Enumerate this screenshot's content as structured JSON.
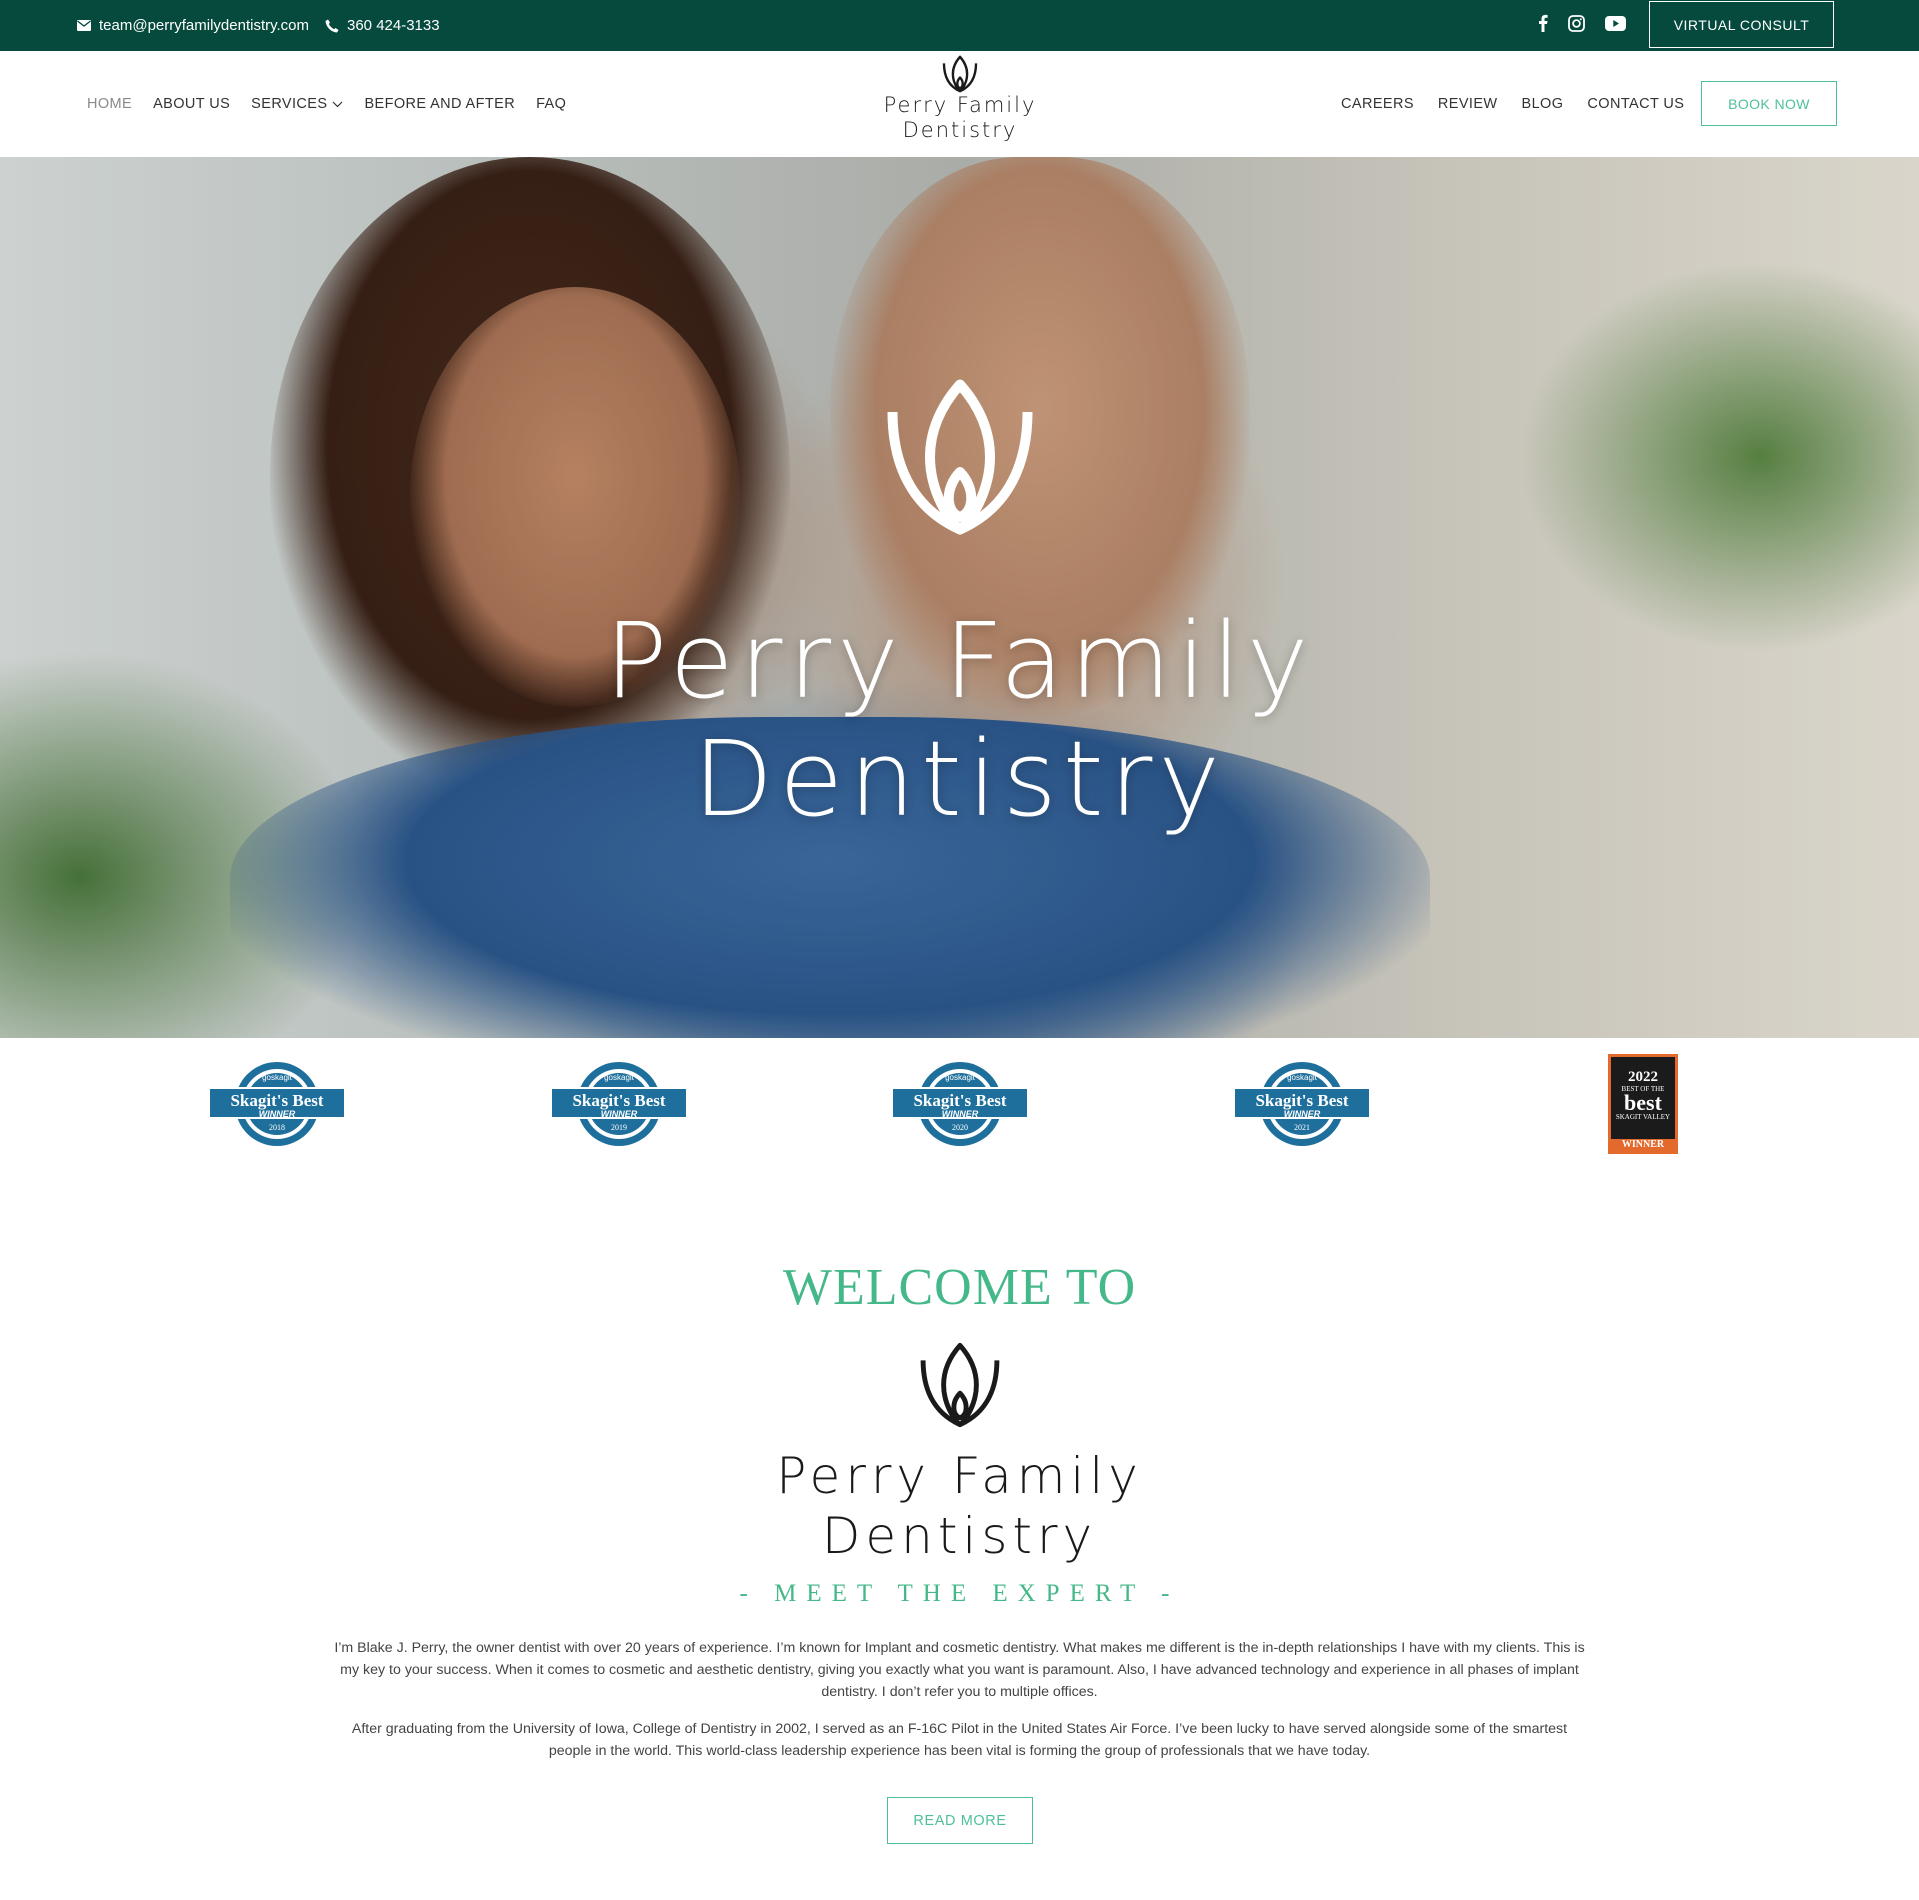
{
  "topbar": {
    "email": "team@perryfamilydentistry.com",
    "phone": "360 424-3133",
    "virtual_consult": "VIRTUAL CONSULT",
    "social_icons": [
      "facebook-icon",
      "instagram-icon",
      "youtube-icon"
    ]
  },
  "nav": {
    "left": [
      "HOME",
      "ABOUT US",
      "SERVICES",
      "BEFORE AND AFTER",
      "FAQ"
    ],
    "right": [
      "CAREERS",
      "REVIEW",
      "BLOG",
      "CONTACT US"
    ],
    "book_now": "BOOK NOW"
  },
  "logo": {
    "line1": "Perry Family",
    "line2": "Dentistry"
  },
  "hero": {
    "title_line1": "Perry Family",
    "title_line2": "Dentistry"
  },
  "awards": [
    {
      "brand": "goskagit",
      "title": "Skagit's Best",
      "label": "WINNER",
      "year": "2018"
    },
    {
      "brand": "goskagit",
      "title": "Skagit's Best",
      "label": "WINNER",
      "year": "2019"
    },
    {
      "brand": "goskagit",
      "title": "Skagit's Best",
      "label": "WINNER",
      "year": "2020"
    },
    {
      "brand": "goskagit",
      "title": "Skagit's Best",
      "label": "WINNER",
      "year": "2021"
    },
    {
      "year": "2022",
      "title": "best",
      "subtitle": "BEST OF THE",
      "region": "SKAGIT VALLEY",
      "label": "WINNER"
    }
  ],
  "welcome": {
    "heading": "WELCOME TO",
    "brand_line1": "Perry Family",
    "brand_line2": "Dentistry",
    "subheading": "- MEET THE EXPERT -",
    "paragraph1": "I’m Blake J. Perry, the owner dentist with over 20 years of experience.  I’m known for Implant and cosmetic dentistry.  What makes me different is the in-depth relationships I have with my clients.  This is my key to your success.  When it comes to cosmetic and aesthetic dentistry, giving you exactly what you want is paramount.  Also, I have advanced technology and experience in all phases of implant dentistry.  I don’t refer you to multiple offices.",
    "paragraph2": "After graduating from the University of Iowa, College of Dentistry in 2002, I served as an F-16C Pilot in the United States Air Force.  I’ve been lucky to have served alongside some of the smartest people in the world.  This world-class leadership experience has been vital is forming the group of professionals that we have today.",
    "read_more": "READ MORE"
  },
  "colors": {
    "topbar": "#064a3e",
    "accent": "#4fbf9b",
    "heading_green": "#45b88a",
    "badge_blue": "#1f6f9c"
  }
}
